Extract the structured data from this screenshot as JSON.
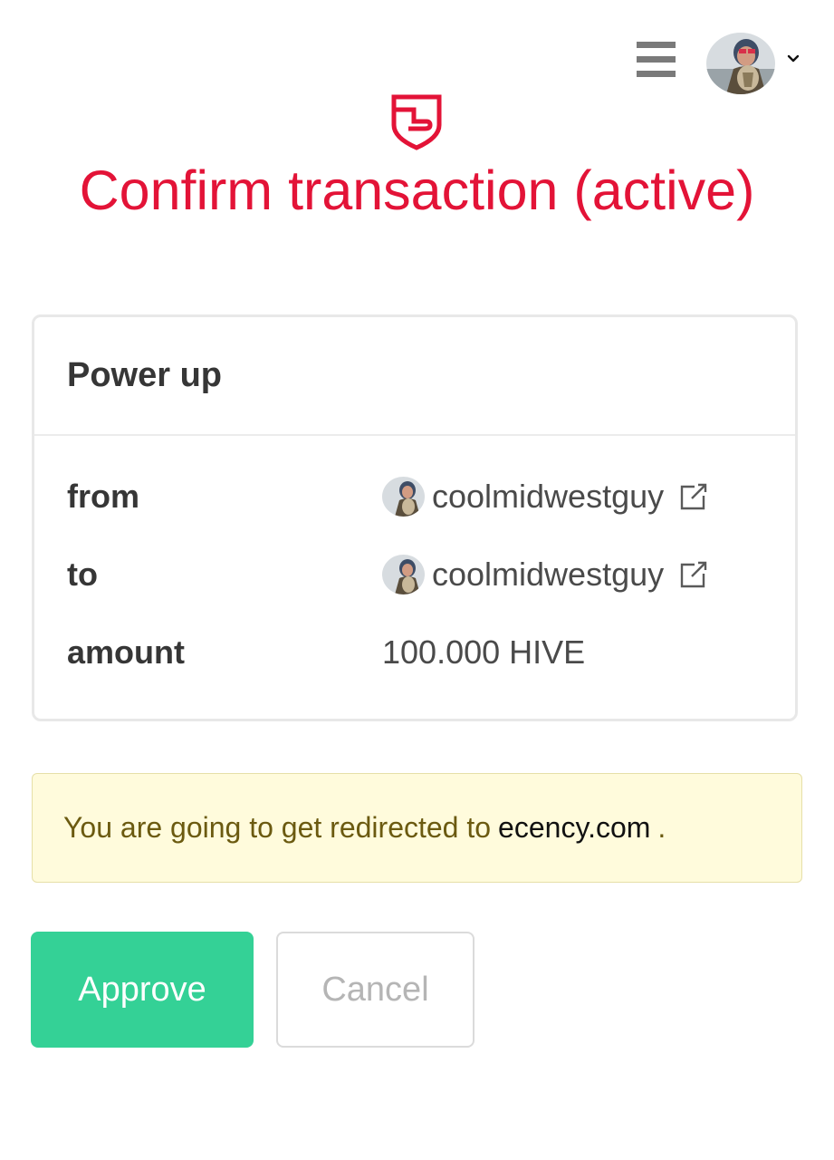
{
  "topbar": {
    "menu_icon": "hamburger-menu-icon",
    "user_avatar_icon": "user-avatar",
    "dropdown_icon": "chevron-down-icon"
  },
  "header": {
    "logo_icon": "hive-shield-icon",
    "title": "Confirm transaction (active)",
    "accent_color": "#e31337"
  },
  "operation": {
    "title": "Power up",
    "rows": [
      {
        "label": "from",
        "value": "coolmidwestguy",
        "has_avatar": true,
        "has_link": true
      },
      {
        "label": "to",
        "value": "coolmidwestguy",
        "has_avatar": true,
        "has_link": true
      },
      {
        "label": "amount",
        "value": "100.000 HIVE",
        "has_avatar": false,
        "has_link": false
      }
    ],
    "link_icon": "external-link-icon"
  },
  "notice": {
    "text": "You are going to get redirected to",
    "domain": "ecency.com",
    "suffix": ".",
    "background_color": "#fffbdc"
  },
  "actions": {
    "approve_label": "Approve",
    "cancel_label": "Cancel",
    "approve_color": "#34d196"
  }
}
